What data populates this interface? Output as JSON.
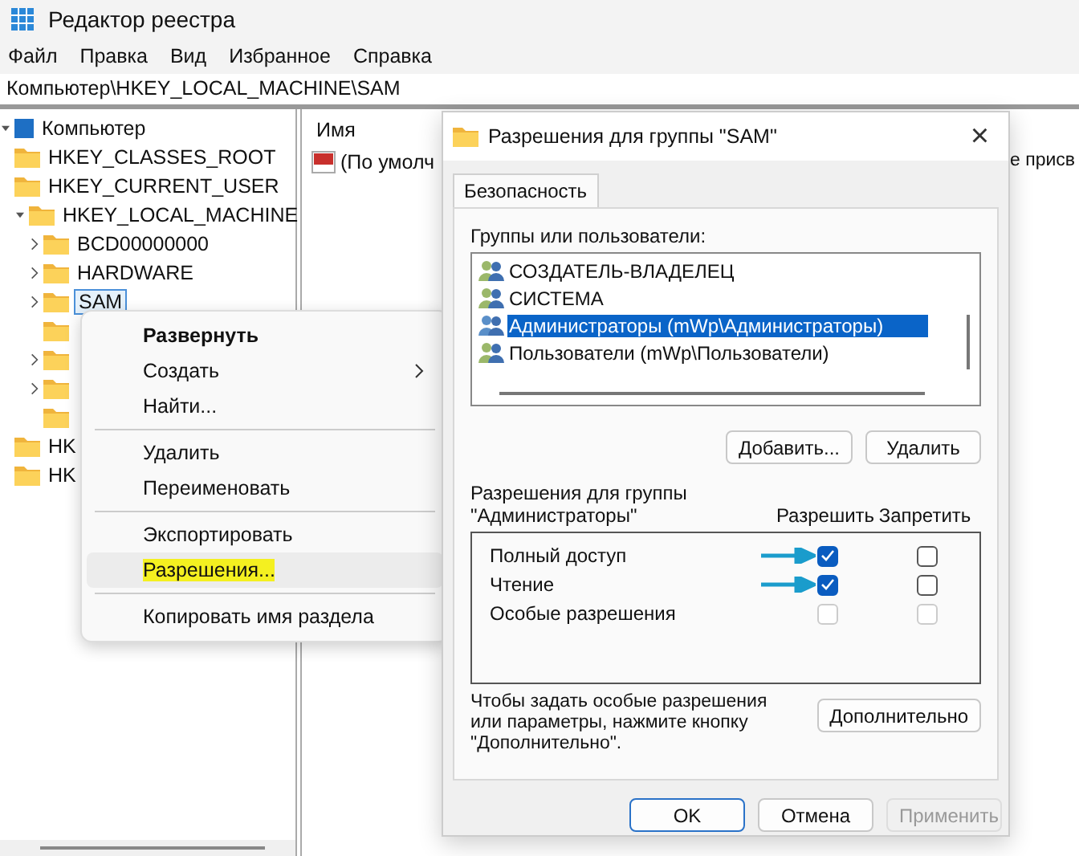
{
  "window": {
    "title": "Редактор реестра"
  },
  "menu": [
    "Файл",
    "Правка",
    "Вид",
    "Избранное",
    "Справка"
  ],
  "address": "Компьютер\\HKEY_LOCAL_MACHINE\\SAM",
  "tree": {
    "label": "Компьютер",
    "expanded": true,
    "children": [
      {
        "label": "HKEY_CLASSES_ROOT",
        "expandable": false,
        "selected": false
      },
      {
        "label": "HKEY_CURRENT_USER",
        "expandable": false,
        "selected": false
      },
      {
        "label": "HKEY_LOCAL_MACHINE",
        "expandable": true,
        "expanded": true,
        "selected": false,
        "children": [
          {
            "label": "BCD00000000",
            "expandable": true,
            "selected": false
          },
          {
            "label": "HARDWARE",
            "expandable": true,
            "selected": false
          },
          {
            "label": "SAM",
            "expandable": true,
            "selected": true
          },
          {
            "expandable": false
          },
          {
            "expandable": true
          },
          {
            "expandable": true
          },
          {
            "expandable": false
          }
        ]
      },
      {
        "label": "HK",
        "expandable": false,
        "selected": false
      },
      {
        "label": "HK",
        "expandable": false,
        "selected": false
      }
    ]
  },
  "values": {
    "columns": [
      "Имя"
    ],
    "rows": [
      {
        "name": "(По умолч",
        "column_3": "е присв"
      }
    ]
  },
  "context_menu": [
    {
      "kind": "item",
      "label": "Развернуть",
      "bold": true,
      "submenu": false,
      "selected": false,
      "highlighted": false
    },
    {
      "kind": "item",
      "label": "Создать",
      "bold": false,
      "submenu": true,
      "selected": false,
      "highlighted": false
    },
    {
      "kind": "item",
      "label": "Найти...",
      "bold": false,
      "submenu": false,
      "selected": false,
      "highlighted": false
    },
    {
      "kind": "separator"
    },
    {
      "kind": "item",
      "label": "Удалить",
      "bold": false,
      "submenu": false,
      "selected": false,
      "highlighted": false
    },
    {
      "kind": "item",
      "label": "Переименовать",
      "bold": false,
      "submenu": false,
      "selected": false,
      "highlighted": false
    },
    {
      "kind": "separator"
    },
    {
      "kind": "item",
      "label": "Экспортировать",
      "bold": false,
      "submenu": false,
      "selected": false,
      "highlighted": false
    },
    {
      "kind": "item",
      "label": "Разрешения...",
      "bold": false,
      "submenu": false,
      "selected": true,
      "highlighted": true
    },
    {
      "kind": "separator"
    },
    {
      "kind": "item",
      "label": "Копировать имя раздела",
      "bold": false,
      "submenu": false,
      "selected": false,
      "highlighted": false
    }
  ],
  "dialog": {
    "title": "Разрешения для группы \"SAM\"",
    "close": "×",
    "tabs": [
      {
        "label": "Безопасность",
        "selected": true
      }
    ],
    "groups_label": "Группы или пользователи:",
    "users": [
      {
        "name": "СОЗДАТЕЛЬ-ВЛАДЕЛЕЦ",
        "selected": false
      },
      {
        "name": "СИСТЕМА",
        "selected": false
      },
      {
        "name": "Администраторы (mWp\\Администраторы)",
        "selected": true
      },
      {
        "name": "Пользователи (mWp\\Пользователи)",
        "selected": false
      }
    ],
    "user_buttons": [
      "Добавить...",
      "Удалить"
    ],
    "permissions_label": "Разрешения для группы\n\"Администраторы\"",
    "permission_columns": [
      "Разрешить",
      "Запретить"
    ],
    "permissions": [
      {
        "name": "Полный доступ",
        "allow": true,
        "deny": false,
        "disabled": false,
        "marked": true
      },
      {
        "name": "Чтение",
        "allow": true,
        "deny": false,
        "disabled": false,
        "marked": true
      },
      {
        "name": "Особые разрешения",
        "allow": false,
        "deny": false,
        "disabled": true,
        "marked": false
      }
    ],
    "note": "Чтобы задать особые разрешения или параметры, нажмите кнопку \"Дополнительно\".",
    "advanced_button": "Дополнительно",
    "buttons": [
      {
        "label": "OK",
        "default": true,
        "disabled": false
      },
      {
        "label": "Отмена",
        "default": false,
        "disabled": false
      },
      {
        "label": "Применить",
        "default": false,
        "disabled": true
      }
    ]
  }
}
